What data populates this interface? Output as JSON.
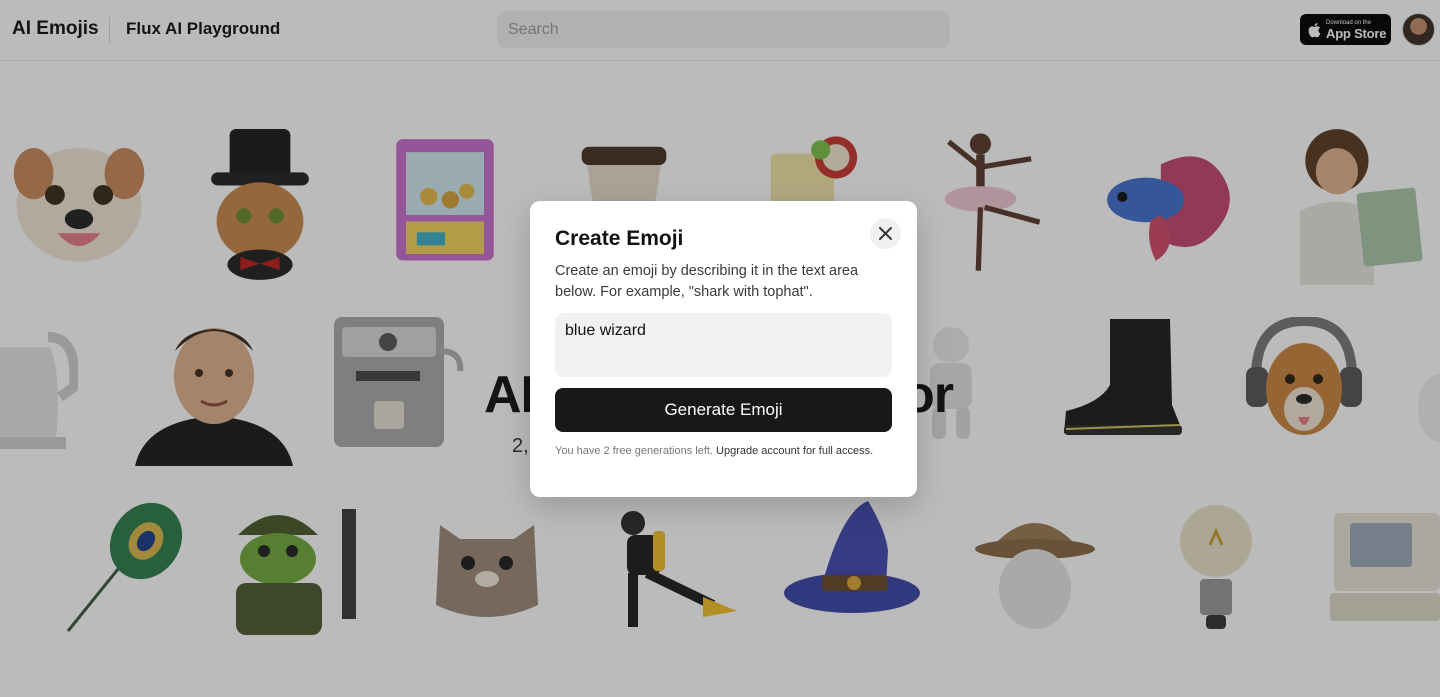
{
  "header": {
    "brand": "AI Emojis",
    "nav_link": "Flux AI Playground",
    "search_placeholder": "Search",
    "appstore_small": "Download on the",
    "appstore_big": "App Store"
  },
  "background": {
    "hero_title_left": "AI",
    "hero_title_right": "or",
    "hero_sub_left": "2,",
    "hero_sub_right": "!",
    "emojis": [
      "bulldog-emoji",
      "cat-tophat-emoji",
      "claw-machine-emoji",
      "coffee-cup-emoji",
      "lemonade-emoji",
      "ballerina-emoji",
      "betta-fish-emoji",
      "painter-man-emoji",
      "kettle-emoji",
      "man-portrait-emoji",
      "espresso-machine-emoji",
      "astronaut-emoji",
      "boot-emoji",
      "dog-headphones-emoji",
      "peacock-feather-emoji",
      "frog-soldier-emoji",
      "cat-emoji",
      "scuba-diver-emoji",
      "wizard-hat-emoji",
      "fedora-mannequin-emoji",
      "lightbulb-emoji",
      "retro-computer-emoji"
    ]
  },
  "modal": {
    "title": "Create Emoji",
    "description": "Create an emoji by describing it in the text area below. For example, \"shark with tophat\".",
    "prompt_value": "blue wizard",
    "generate_label": "Generate Emoji",
    "note_text": "You have 2 free generations left. ",
    "upgrade_link": "Upgrade account for full access."
  },
  "colors": {
    "button_dark": "#18181b",
    "input_bg": "#f1f1f3",
    "overlay": "rgba(30,30,30,0.30)"
  }
}
